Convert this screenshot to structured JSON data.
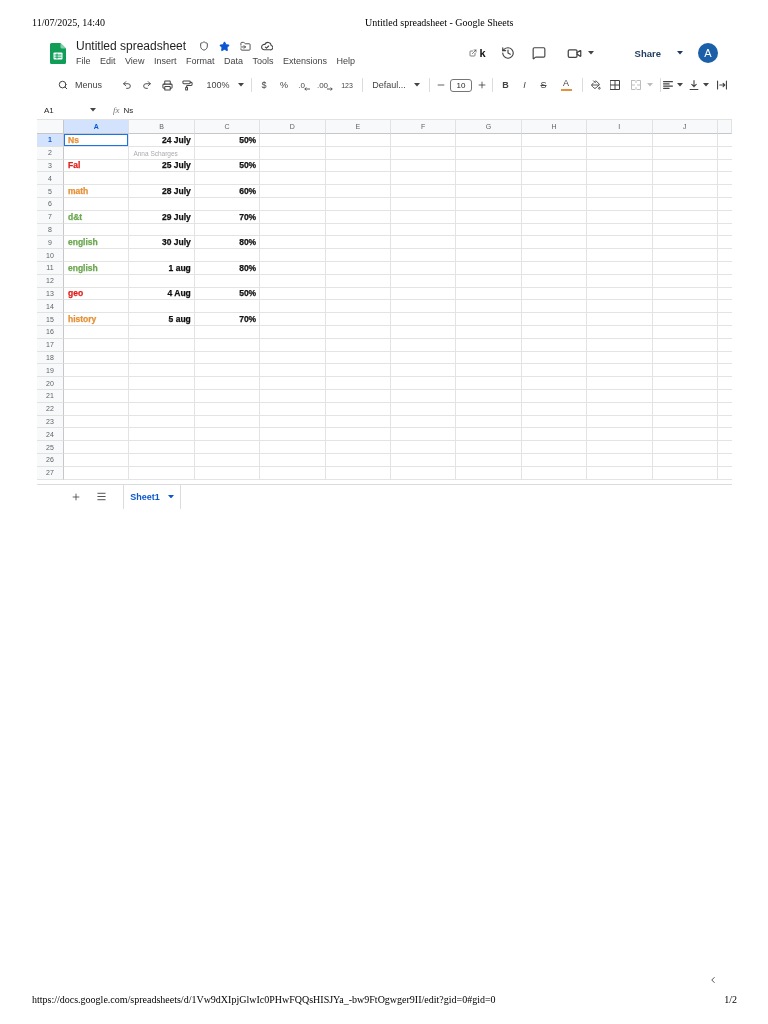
{
  "print_header": {
    "datetime": "11/07/2025, 14:40",
    "page_title": "Untitled spreadsheet - Google Sheets"
  },
  "document": {
    "title": "Untitled spreadsheet",
    "starred": true
  },
  "menus": [
    "File",
    "Edit",
    "View",
    "Insert",
    "Format",
    "Data",
    "Tools",
    "Extensions",
    "Help"
  ],
  "header_actions": {
    "extension_label": "k",
    "share": "Share",
    "avatar": "A"
  },
  "toolbar": {
    "search": "Menus",
    "zoom": "100%",
    "currency": "$",
    "percent": "%",
    "decrease_decimal": ".0",
    "increase_decimal": ".00",
    "number_format": "123",
    "font": "Defaul...",
    "font_size": "10",
    "bold": "B",
    "italic": "I",
    "strikethrough": "S",
    "text_color": "A",
    "merge_cells": {
      "disabled": true
    }
  },
  "formula_bar": {
    "name_box": "A1",
    "fx": "fx",
    "value": "Ns"
  },
  "grid": {
    "columns": [
      {
        "label": "A",
        "selected": true
      },
      {
        "label": "B",
        "selected": false
      },
      {
        "label": "C",
        "selected": false
      },
      {
        "label": "D",
        "selected": false
      },
      {
        "label": "E",
        "selected": false
      },
      {
        "label": "F",
        "selected": false
      },
      {
        "label": "G",
        "selected": false
      },
      {
        "label": "H",
        "selected": false
      },
      {
        "label": "I",
        "selected": false
      },
      {
        "label": "J",
        "selected": false
      }
    ],
    "rows": [
      {
        "number": "1",
        "selected": true,
        "cells": [
          {
            "text": "Ns",
            "color": "#e69138"
          },
          {
            "text": "24 July"
          },
          {
            "text": "50%"
          }
        ]
      },
      {
        "number": "2",
        "selected": false,
        "collaborator": "Anna Scharges"
      },
      {
        "number": "3",
        "selected": false,
        "cells": [
          {
            "text": "Fal",
            "color": "#e0201c"
          },
          {
            "text": "25 July"
          },
          {
            "text": "50%"
          }
        ]
      },
      {
        "number": "4",
        "selected": false
      },
      {
        "number": "5",
        "selected": false,
        "cells": [
          {
            "text": "math",
            "color": "#e69138"
          },
          {
            "text": "28 July"
          },
          {
            "text": "60%"
          }
        ]
      },
      {
        "number": "6",
        "selected": false
      },
      {
        "number": "7",
        "selected": false,
        "cells": [
          {
            "text": "d&t",
            "color": "#6aa84f"
          },
          {
            "text": "29 July"
          },
          {
            "text": "70%"
          }
        ]
      },
      {
        "number": "8",
        "selected": false
      },
      {
        "number": "9",
        "selected": false,
        "cells": [
          {
            "text": "english",
            "color": "#6aa84f"
          },
          {
            "text": "30 July"
          },
          {
            "text": "80%"
          }
        ]
      },
      {
        "number": "10",
        "selected": false
      },
      {
        "number": "11",
        "selected": false,
        "cells": [
          {
            "text": "english",
            "color": "#6aa84f"
          },
          {
            "text": "1 aug"
          },
          {
            "text": "80%"
          }
        ]
      },
      {
        "number": "12",
        "selected": false
      },
      {
        "number": "13",
        "selected": false,
        "cells": [
          {
            "text": "geo",
            "color": "#e0201c"
          },
          {
            "text": "4 Aug"
          },
          {
            "text": "50%"
          }
        ]
      },
      {
        "number": "14",
        "selected": false
      },
      {
        "number": "15",
        "selected": false,
        "cells": [
          {
            "text": "history",
            "color": "#e69138"
          },
          {
            "text": "5 aug"
          },
          {
            "text": "70%"
          }
        ]
      },
      {
        "number": "16",
        "selected": false
      },
      {
        "number": "17",
        "selected": false
      },
      {
        "number": "18",
        "selected": false
      },
      {
        "number": "19",
        "selected": false
      },
      {
        "number": "20",
        "selected": false
      },
      {
        "number": "21",
        "selected": false
      },
      {
        "number": "22",
        "selected": false
      },
      {
        "number": "23",
        "selected": false
      },
      {
        "number": "24",
        "selected": false
      },
      {
        "number": "25",
        "selected": false
      },
      {
        "number": "26",
        "selected": false
      },
      {
        "number": "27",
        "selected": false
      }
    ]
  },
  "sheet_tabs": [
    {
      "label": "Sheet1",
      "selected": true
    }
  ],
  "print_footer": {
    "url": "https://docs.google.com/spreadsheets/d/1Vw9dXIpjGlwIc0PHwFQQsHISJYa_-bw9FtOgwger9II/edit?gid=0#gid=0",
    "page": "1/2"
  }
}
